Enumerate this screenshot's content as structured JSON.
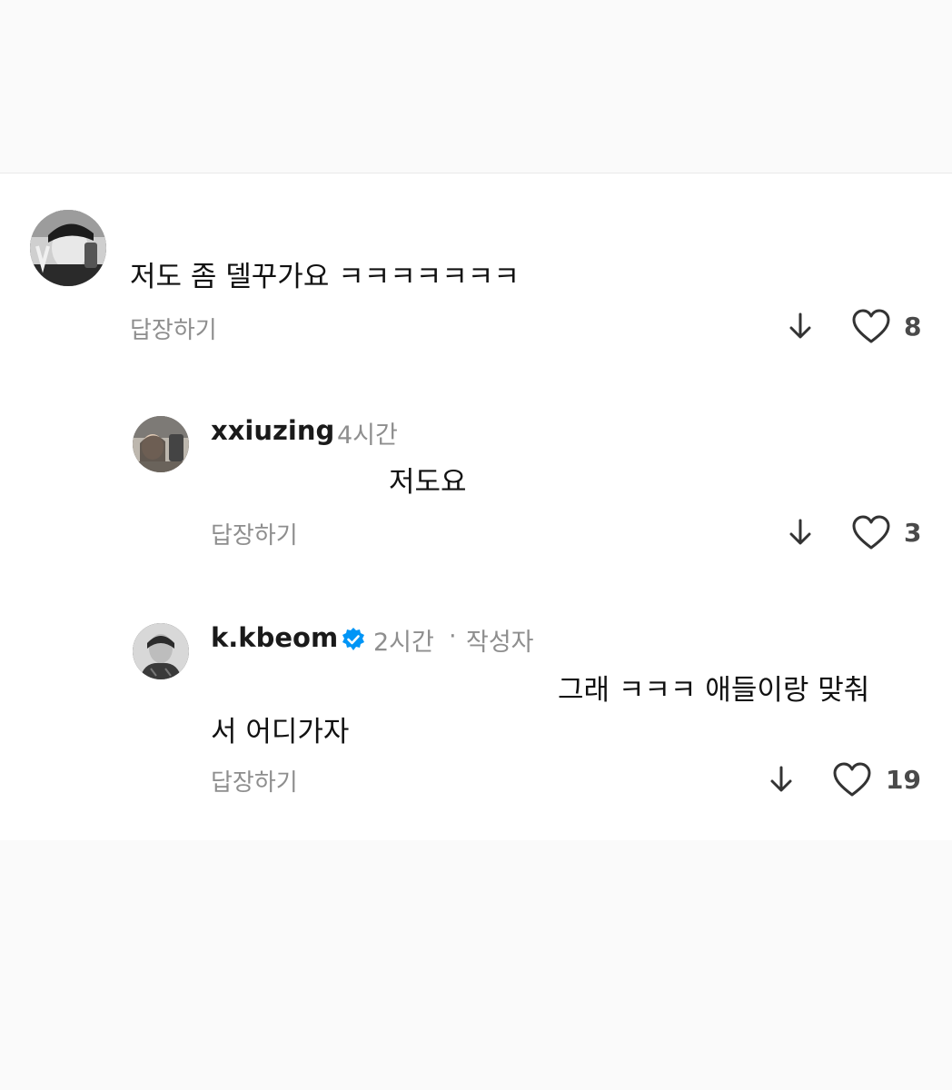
{
  "comments": [
    {
      "username": "",
      "time": "",
      "body": "저도 좀 델꾸가요 ㅋㅋㅋㅋㅋㅋㅋ",
      "reply_label": "답장하기",
      "likes": "8"
    },
    {
      "username": "xxiuzing",
      "time": "4시간",
      "body": "저도요",
      "reply_label": "답장하기",
      "likes": "3"
    },
    {
      "username": "k.kbeom",
      "time": "2시간",
      "separator": "·",
      "author_tag": "작성자",
      "body_line1": "그래 ㅋㅋㅋ 애들이랑 맞춰",
      "body_line2": "서 어디가자",
      "reply_label": "답장하기",
      "likes": "19",
      "verified": true
    }
  ],
  "icons": {
    "down": "arrow-down-icon",
    "like": "heart-icon",
    "verified": "verified-badge-icon"
  },
  "colors": {
    "verified_blue": "#0095f6",
    "muted_text": "#8e8e8e"
  }
}
